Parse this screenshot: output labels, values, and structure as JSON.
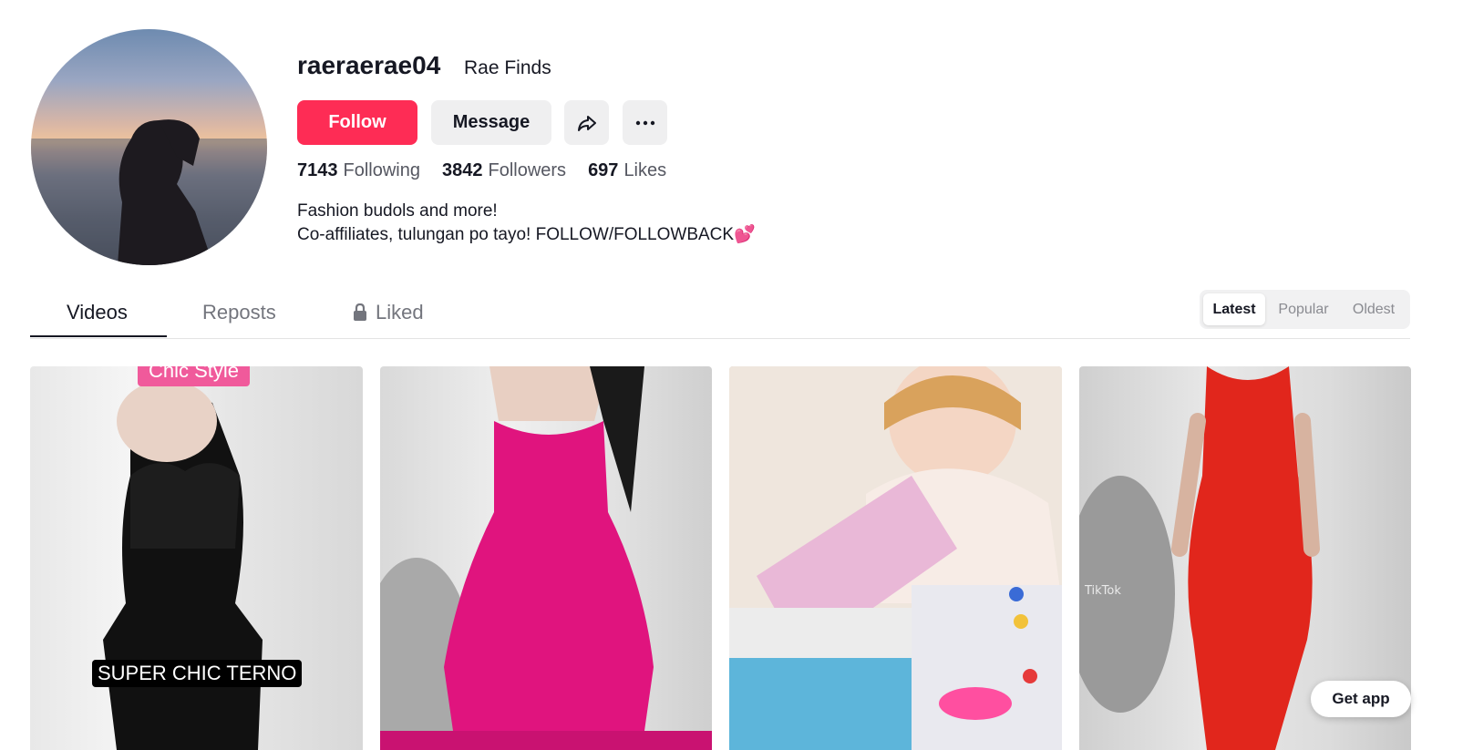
{
  "profile": {
    "username": "raeraerae04",
    "nickname": "Rae Finds",
    "bio_line1": "Fashion budols and more!",
    "bio_line2": "Co-affiliates, tulungan po tayo! FOLLOW/FOLLOWBACK",
    "bio_emoji": "💕"
  },
  "actions": {
    "follow_label": "Follow",
    "message_label": "Message",
    "share_icon": "share-icon",
    "more_icon": "more-icon"
  },
  "stats": {
    "following_count": "7143",
    "following_label": "Following",
    "followers_count": "3842",
    "followers_label": "Followers",
    "likes_count": "697",
    "likes_label": "Likes"
  },
  "tabs": {
    "videos": "Videos",
    "reposts": "Reposts",
    "liked": "Liked"
  },
  "sort": {
    "latest": "Latest",
    "popular": "Popular",
    "oldest": "Oldest"
  },
  "videos": [
    {
      "tag": "Chic Style",
      "caption": "SUPER CHIC TERNO"
    },
    {
      "tag": "",
      "caption": ""
    },
    {
      "tag": "",
      "caption": ""
    },
    {
      "tag": "",
      "caption": ""
    }
  ],
  "get_app_label": "Get app",
  "colors": {
    "accent": "#fe2c55",
    "text": "#161823",
    "muted": "#73757d"
  }
}
